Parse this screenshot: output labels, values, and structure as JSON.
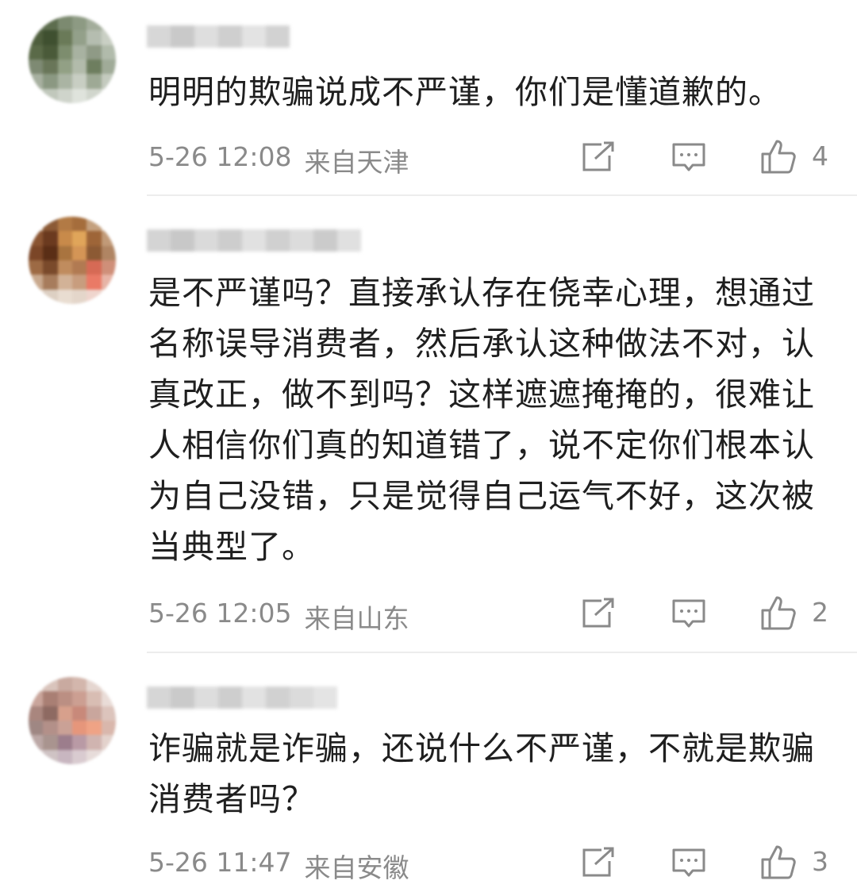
{
  "comments": [
    {
      "text": "明明的欺骗说成不严谨，你们是懂道歉的。",
      "time": "5-26 12:08",
      "location": "来自天津",
      "likes": "4"
    },
    {
      "text": "是不严谨吗？直接承认存在侥幸心理，想通过名称误导消费者，然后承认这种做法不对，认真改正，做不到吗？这样遮遮掩掩的，很难让人相信你们真的知道错了，说不定你们根本认为自己没错，只是觉得自己运气不好，这次被当典型了。",
      "time": "5-26 12:05",
      "location": "来自山东",
      "likes": "2"
    },
    {
      "text": "诈骗就是诈骗，还说什么不严谨，不就是欺骗消费者吗？",
      "time": "5-26 11:47",
      "location": "来自安徽",
      "likes": "3"
    }
  ],
  "icons": {
    "share": "share-icon",
    "reply": "comment-icon",
    "like": "thumbs-up-icon"
  },
  "colors": {
    "text": "#1f1f1f",
    "meta": "#8a8a8a",
    "divider": "#ededed"
  }
}
